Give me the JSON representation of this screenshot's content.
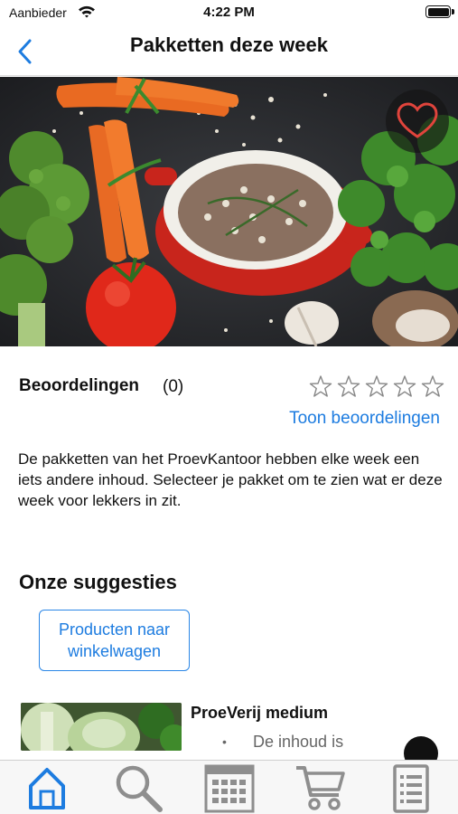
{
  "status_bar": {
    "carrier": "Aanbieder",
    "time": "4:22 PM"
  },
  "nav": {
    "title": "Pakketten deze week",
    "back_icon": "chevron-left-icon"
  },
  "hero": {
    "image": "vegetables-photo",
    "favorite_icon": "heart-outline-icon"
  },
  "ratings": {
    "title": "Beoordelingen",
    "count": "(0)",
    "stars_filled": 0,
    "stars_total": 5,
    "show_link": "Toon beoordelingen"
  },
  "description": "De pakketten van het ProevKantoor hebben elke week een iets andere inhoud. Selecteer je pakket om te zien wat er deze week voor lekkers in zit.",
  "suggestions": {
    "title": "Onze suggesties",
    "add_button_label": "Producten naar winkelwagen",
    "products": [
      {
        "name": "ProeVerij medium",
        "bullet": "•",
        "description": "De inhoud is"
      }
    ]
  },
  "tab_bar": {
    "active_index": 0,
    "tabs": [
      {
        "icon": "home-icon"
      },
      {
        "icon": "search-icon"
      },
      {
        "icon": "calendar-icon"
      },
      {
        "icon": "cart-icon"
      },
      {
        "icon": "list-icon"
      }
    ]
  },
  "colors": {
    "accent": "#1d7ce0",
    "heart": "#e0443c",
    "tab_inactive": "#8e8e8e"
  }
}
